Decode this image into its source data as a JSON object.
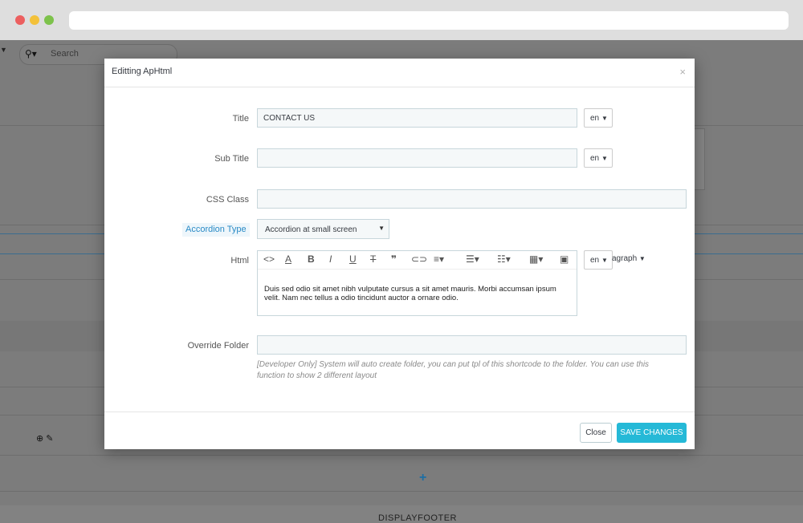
{
  "background": {
    "search_placeholder": "Search",
    "footer_label": "DISPLAYFOOTER",
    "add_icon": "plus-icon"
  },
  "modal": {
    "title": "Editting ApHtml",
    "close_glyph": "×",
    "fields": {
      "title": {
        "label": "Title",
        "value": "CONTACT US",
        "lang": "en"
      },
      "subtitle": {
        "label": "Sub Title",
        "value": "",
        "lang": "en"
      },
      "css_class": {
        "label": "CSS Class",
        "value": ""
      },
      "accordion_type": {
        "label": "Accordion Type",
        "value": "Accordion at small screen"
      },
      "html": {
        "label": "Html",
        "lang": "en",
        "paragraph_label": "agraph",
        "content": "Duis sed odio sit amet nibh vulputate cursus a sit amet mauris. Morbi accumsan ipsum velit. Nam nec tellus a odio tincidunt auctor a ornare odio."
      },
      "override_folder": {
        "label": "Override Folder",
        "value": "",
        "help": "[Developer Only] System will auto create folder, you can put tpl of this shortcode to the folder. You can use this function to show 2 different layout"
      }
    },
    "footer": {
      "close_label": "Close",
      "save_label": "SAVE CHANGES"
    }
  },
  "colors": {
    "accent": "#25b9d7",
    "chip_text": "#2a8bc6"
  }
}
